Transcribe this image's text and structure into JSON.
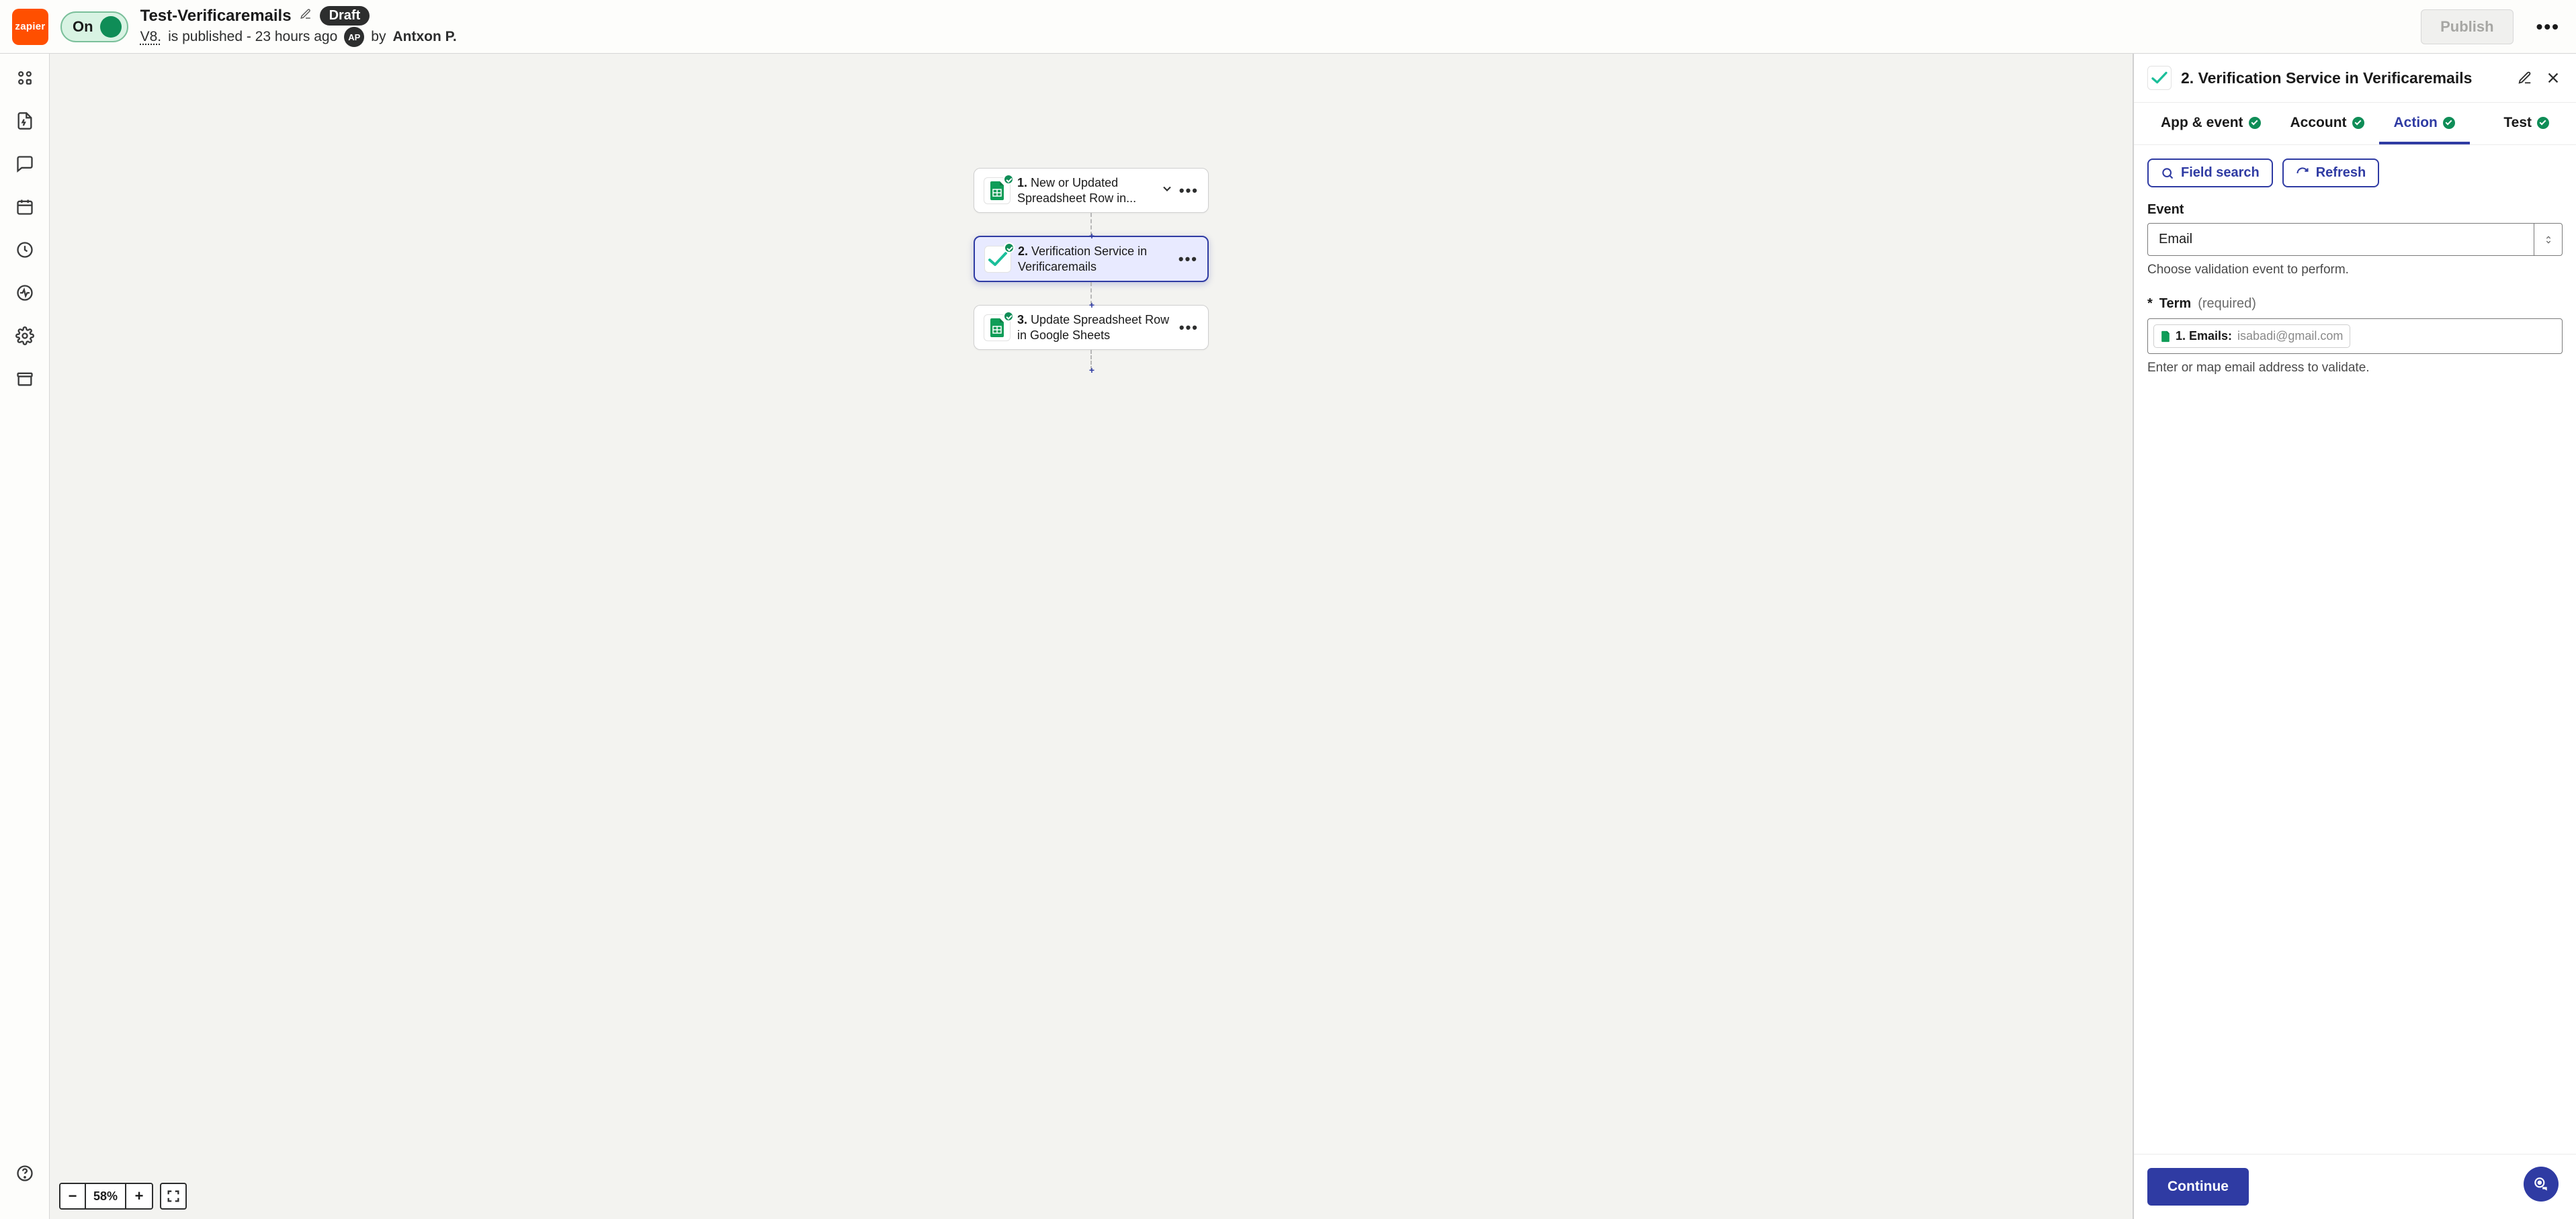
{
  "header": {
    "brand": "zapier",
    "toggle_label": "On",
    "zap_title": "Test-Verificaremails",
    "draft_badge": "Draft",
    "version": "V8.",
    "publish_status": "is published - 23 hours ago",
    "avatar_initials": "AP",
    "by_label": "by",
    "author": "Antxon P.",
    "publish_button": "Publish"
  },
  "flow": {
    "nodes": [
      {
        "order": "1.",
        "title": "New or Updated Spreadsheet Row in...",
        "icon": "sheets"
      },
      {
        "order": "2.",
        "title": "Verification Service in Verificaremails",
        "icon": "check"
      },
      {
        "order": "3.",
        "title": "Update Spreadsheet Row in Google Sheets",
        "icon": "sheets"
      }
    ]
  },
  "zoom": {
    "value": "58%"
  },
  "panel": {
    "title": "2. Verification Service in Verificaremails",
    "tabs": {
      "app_event": "App & event",
      "account": "Account",
      "action": "Action",
      "test": "Test"
    },
    "buttons": {
      "field_search": "Field search",
      "refresh": "Refresh",
      "continue": "Continue"
    },
    "event": {
      "label": "Event",
      "value": "Email",
      "hint": "Choose validation event to perform."
    },
    "term": {
      "star": "*",
      "name": "Term",
      "required": "(required)",
      "token_label": "1. Emails:",
      "token_sample": "isabadi@gmail.com",
      "hint": "Enter or map email address to validate."
    }
  }
}
